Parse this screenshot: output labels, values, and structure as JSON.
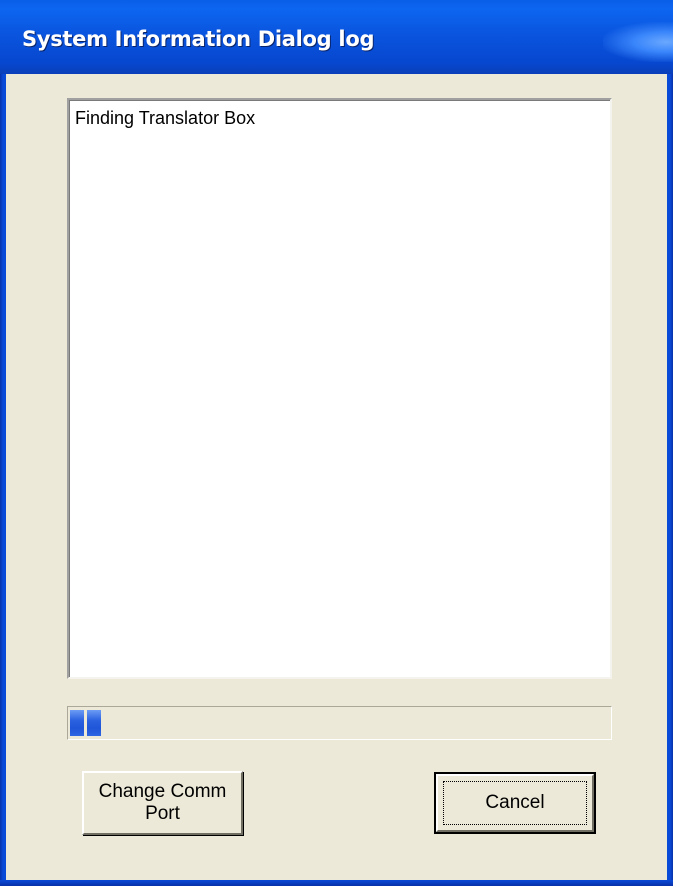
{
  "window": {
    "title": "System Information Dialog log"
  },
  "log": {
    "lines": [
      "Finding Translator Box"
    ]
  },
  "progress": {
    "blocks_filled": 2,
    "accent": "#2b62e0"
  },
  "buttons": {
    "change_comm_port_line1": "Change Comm",
    "change_comm_port_line2": "Port",
    "cancel": "Cancel"
  },
  "colors": {
    "titlebar": "#0a55df",
    "dialog_bg": "#ece9d8",
    "listbox_bg": "#ffffff"
  }
}
